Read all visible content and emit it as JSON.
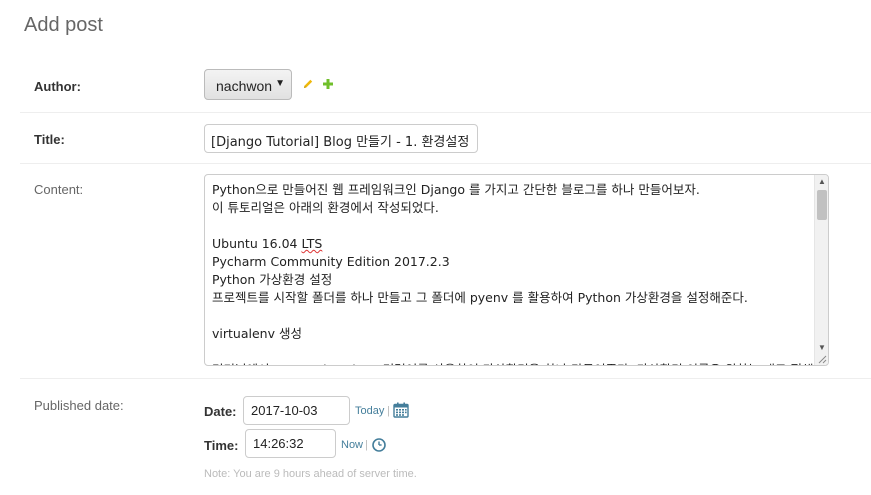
{
  "page": {
    "title": "Add post"
  },
  "author": {
    "label": "Author:",
    "selected": "nachwon",
    "caret": "▼",
    "edit_icon": "pencil-icon",
    "add_icon": "plus-icon"
  },
  "title_field": {
    "label": "Title:",
    "value": "[Django Tutorial] Blog 만들기 - 1. 환경설정"
  },
  "content": {
    "label": "Content:",
    "lines": [
      "Python으로 만들어진 웹 프레임워크인 Django 를 가지고 간단한 블로그를 하나 만들어보자.",
      "이 튜토리얼은 아래의 환경에서 작성되었다.",
      "",
      "Ubuntu 16.04 LTS",
      "Pycharm Community Edition 2017.2.3",
      "Python 가상환경 설정",
      "프로젝트를 시작할 폴더를 하나 만들고 그 폴더에 pyenv 를 활용하여 Python 가상환경을 설정해준다.",
      "",
      "virtualenv 생성",
      "",
      "터미널에서 pyenv virtualenv 명령어를 사용하여 가상환경을 하나 만들어준다. 가상환경 이름은 원하는 대로 정해주면 된다."
    ]
  },
  "published": {
    "label": "Published date:",
    "date_label": "Date:",
    "date_value": "2017-10-03",
    "today_link": "Today",
    "time_label": "Time:",
    "time_value": "14:26:32",
    "now_link": "Now",
    "separator": "|",
    "help_text": "Note: You are 9 hours ahead of server time."
  }
}
